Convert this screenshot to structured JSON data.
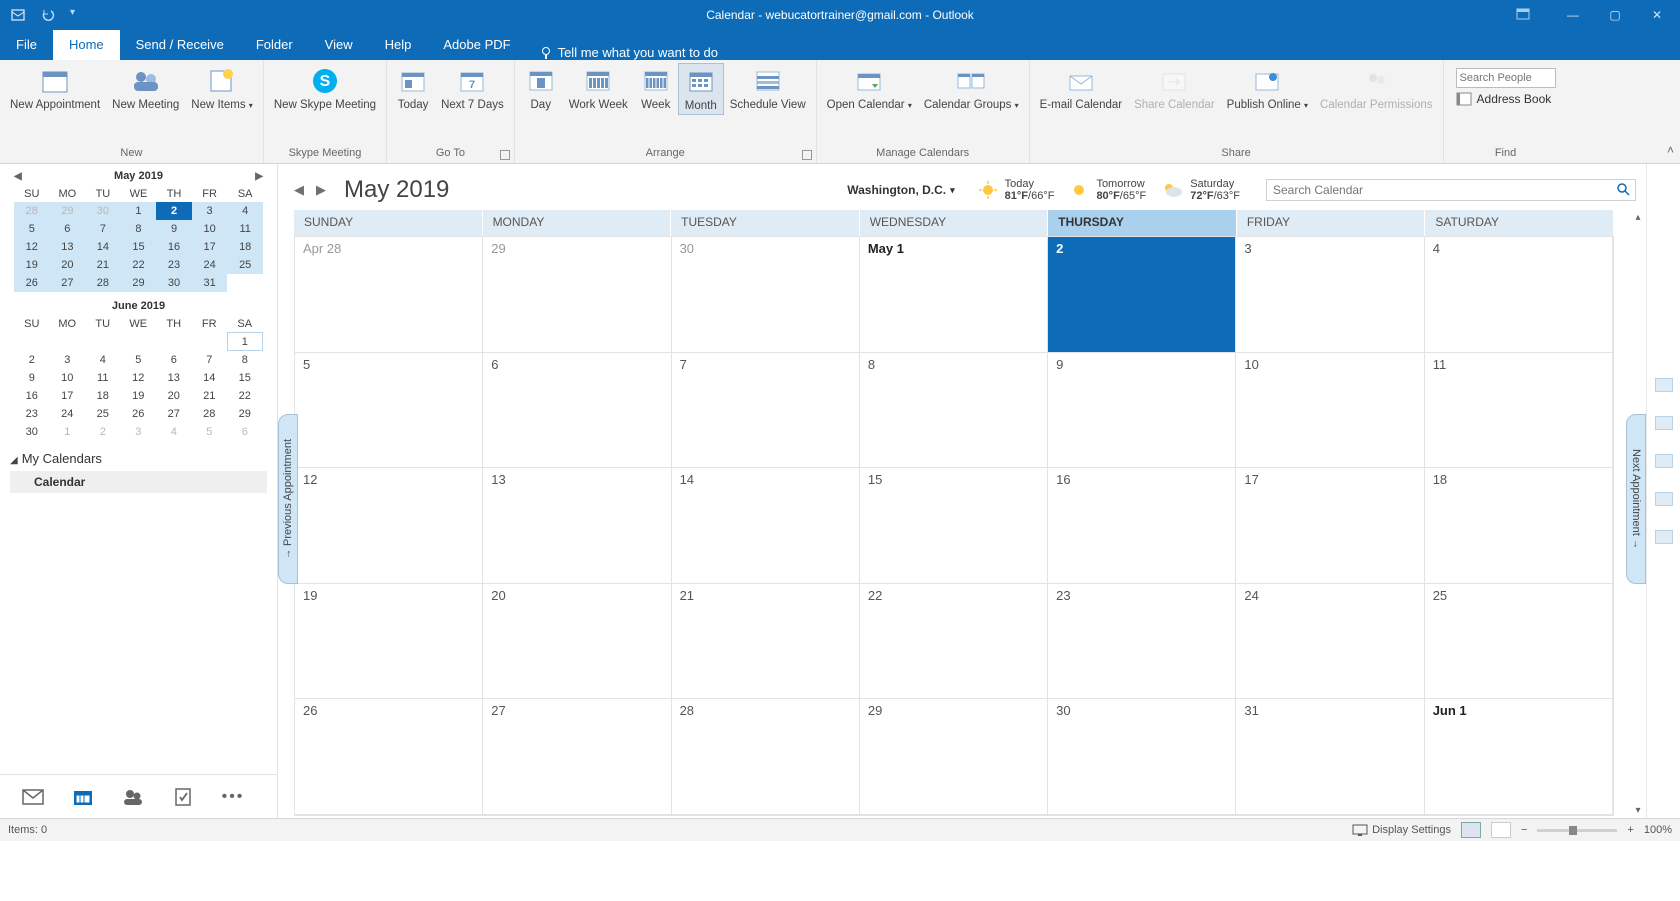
{
  "titlebar": {
    "title": "Calendar - webucatortrainer@gmail.com  -  Outlook"
  },
  "tabs": [
    "File",
    "Home",
    "Send / Receive",
    "Folder",
    "View",
    "Help",
    "Adobe PDF"
  ],
  "active_tab": "Home",
  "tellme": "Tell me what you want to do",
  "ribbon": {
    "new": {
      "label": "New",
      "appointment": "New Appointment",
      "meeting": "New Meeting",
      "items": "New Items"
    },
    "skype": {
      "label": "Skype Meeting",
      "btn": "New Skype Meeting"
    },
    "goto": {
      "label": "Go To",
      "today": "Today",
      "next7": "Next 7 Days"
    },
    "arrange": {
      "label": "Arrange",
      "day": "Day",
      "workweek": "Work Week",
      "week": "Week",
      "month": "Month",
      "schedule": "Schedule View"
    },
    "manage": {
      "label": "Manage Calendars",
      "open": "Open Calendar",
      "groups": "Calendar Groups"
    },
    "share": {
      "label": "Share",
      "email": "E-mail Calendar",
      "shareBtn": "Share Calendar",
      "publish": "Publish Online",
      "perms": "Calendar Permissions"
    },
    "find": {
      "label": "Find",
      "search_placeholder": "Search People",
      "addr": "Address Book"
    }
  },
  "mini1": {
    "title": "May 2019",
    "dows": [
      "SU",
      "MO",
      "TU",
      "WE",
      "TH",
      "FR",
      "SA"
    ],
    "rows": [
      [
        {
          "d": 28,
          "f": 1,
          "h": 1
        },
        {
          "d": 29,
          "f": 1,
          "h": 1
        },
        {
          "d": 30,
          "f": 1,
          "h": 1
        },
        {
          "d": 1,
          "h": 1
        },
        {
          "d": 2,
          "t": 1
        },
        {
          "d": 3,
          "h": 1
        },
        {
          "d": 4,
          "h": 1
        }
      ],
      [
        {
          "d": 5,
          "h": 1
        },
        {
          "d": 6,
          "h": 1
        },
        {
          "d": 7,
          "h": 1
        },
        {
          "d": 8,
          "h": 1
        },
        {
          "d": 9,
          "h": 1
        },
        {
          "d": 10,
          "h": 1
        },
        {
          "d": 11,
          "h": 1
        }
      ],
      [
        {
          "d": 12,
          "h": 1
        },
        {
          "d": 13,
          "h": 1
        },
        {
          "d": 14,
          "h": 1
        },
        {
          "d": 15,
          "h": 1
        },
        {
          "d": 16,
          "h": 1
        },
        {
          "d": 17,
          "h": 1
        },
        {
          "d": 18,
          "h": 1
        }
      ],
      [
        {
          "d": 19,
          "h": 1
        },
        {
          "d": 20,
          "h": 1
        },
        {
          "d": 21,
          "h": 1
        },
        {
          "d": 22,
          "h": 1
        },
        {
          "d": 23,
          "h": 1
        },
        {
          "d": 24,
          "h": 1
        },
        {
          "d": 25,
          "h": 1
        }
      ],
      [
        {
          "d": 26,
          "h": 1
        },
        {
          "d": 27,
          "h": 1
        },
        {
          "d": 28,
          "h": 1
        },
        {
          "d": 29,
          "h": 1
        },
        {
          "d": 30,
          "h": 1
        },
        {
          "d": 31,
          "h": 1
        },
        {
          "d": ""
        }
      ]
    ]
  },
  "mini2": {
    "title": "June 2019",
    "dows": [
      "SU",
      "MO",
      "TU",
      "WE",
      "TH",
      "FR",
      "SA"
    ],
    "rows": [
      [
        {
          "d": ""
        },
        {
          "d": ""
        },
        {
          "d": ""
        },
        {
          "d": ""
        },
        {
          "d": ""
        },
        {
          "d": ""
        },
        {
          "d": 1,
          "b": 1
        }
      ],
      [
        {
          "d": 2
        },
        {
          "d": 3
        },
        {
          "d": 4
        },
        {
          "d": 5
        },
        {
          "d": 6
        },
        {
          "d": 7
        },
        {
          "d": 8
        }
      ],
      [
        {
          "d": 9
        },
        {
          "d": 10
        },
        {
          "d": 11
        },
        {
          "d": 12
        },
        {
          "d": 13
        },
        {
          "d": 14
        },
        {
          "d": 15
        }
      ],
      [
        {
          "d": 16
        },
        {
          "d": 17
        },
        {
          "d": 18
        },
        {
          "d": 19
        },
        {
          "d": 20
        },
        {
          "d": 21
        },
        {
          "d": 22
        }
      ],
      [
        {
          "d": 23
        },
        {
          "d": 24
        },
        {
          "d": 25
        },
        {
          "d": 26
        },
        {
          "d": 27
        },
        {
          "d": 28
        },
        {
          "d": 29
        }
      ],
      [
        {
          "d": 30
        },
        {
          "d": 1,
          "f": 1
        },
        {
          "d": 2,
          "f": 1
        },
        {
          "d": 3,
          "f": 1
        },
        {
          "d": 4,
          "f": 1
        },
        {
          "d": 5,
          "f": 1
        },
        {
          "d": 6,
          "f": 1
        }
      ]
    ]
  },
  "mycals": {
    "header": "My Calendars",
    "item": "Calendar"
  },
  "calview": {
    "title": "May 2019",
    "location": "Washington,  D.C.",
    "wx": [
      {
        "label": "Today",
        "temp": "81°F/66°F"
      },
      {
        "label": "Tomorrow",
        "temp": "80°F/65°F"
      },
      {
        "label": "Saturday",
        "temp": "72°F/63°F"
      }
    ],
    "search_placeholder": "Search Calendar",
    "dows": [
      "SUNDAY",
      "MONDAY",
      "TUESDAY",
      "WEDNESDAY",
      "THURSDAY",
      "FRIDAY",
      "SATURDAY"
    ],
    "today_col": 4,
    "cells": [
      [
        {
          "t": "Apr 28",
          "f": 1
        },
        {
          "t": "29",
          "f": 1
        },
        {
          "t": "30",
          "f": 1
        },
        {
          "t": "May 1",
          "bold": 1
        },
        {
          "t": "2",
          "today": 1
        },
        {
          "t": "3"
        },
        {
          "t": "4"
        }
      ],
      [
        {
          "t": "5"
        },
        {
          "t": "6"
        },
        {
          "t": "7"
        },
        {
          "t": "8"
        },
        {
          "t": "9"
        },
        {
          "t": "10"
        },
        {
          "t": "11"
        }
      ],
      [
        {
          "t": "12"
        },
        {
          "t": "13"
        },
        {
          "t": "14"
        },
        {
          "t": "15"
        },
        {
          "t": "16"
        },
        {
          "t": "17"
        },
        {
          "t": "18"
        }
      ],
      [
        {
          "t": "19"
        },
        {
          "t": "20"
        },
        {
          "t": "21"
        },
        {
          "t": "22"
        },
        {
          "t": "23"
        },
        {
          "t": "24"
        },
        {
          "t": "25"
        }
      ],
      [
        {
          "t": "26"
        },
        {
          "t": "27"
        },
        {
          "t": "28"
        },
        {
          "t": "29"
        },
        {
          "t": "30"
        },
        {
          "t": "31"
        },
        {
          "t": "Jun 1",
          "bold": 1
        }
      ]
    ],
    "prev_apt": "Previous Appointment",
    "next_apt": "Next Appointment"
  },
  "status": {
    "items": "Items: 0",
    "display": "Display Settings",
    "zoom": "100%"
  }
}
